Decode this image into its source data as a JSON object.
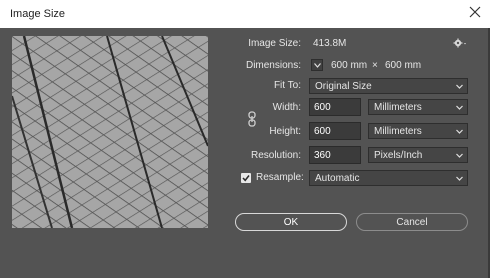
{
  "window": {
    "title": "Image Size"
  },
  "image_size": {
    "label": "Image Size:",
    "value": "413.8M"
  },
  "dimensions": {
    "label": "Dimensions:",
    "width": "600 mm",
    "times": "×",
    "height": "600 mm"
  },
  "fit_to": {
    "label": "Fit To:",
    "value": "Original Size"
  },
  "width": {
    "label": "Width:",
    "value": "600",
    "unit": "Millimeters"
  },
  "height": {
    "label": "Height:",
    "value": "600",
    "unit": "Millimeters"
  },
  "resolution": {
    "label": "Resolution:",
    "value": "360",
    "unit": "Pixels/Inch"
  },
  "resample": {
    "label": "Resample:",
    "checked": true,
    "value": "Automatic"
  },
  "buttons": {
    "ok": "OK",
    "cancel": "Cancel"
  },
  "icons": {
    "close": "close-icon",
    "gear": "gear-icon",
    "link": "link-icon",
    "chevron": "chevron-down-icon",
    "check": "checkmark-icon"
  }
}
